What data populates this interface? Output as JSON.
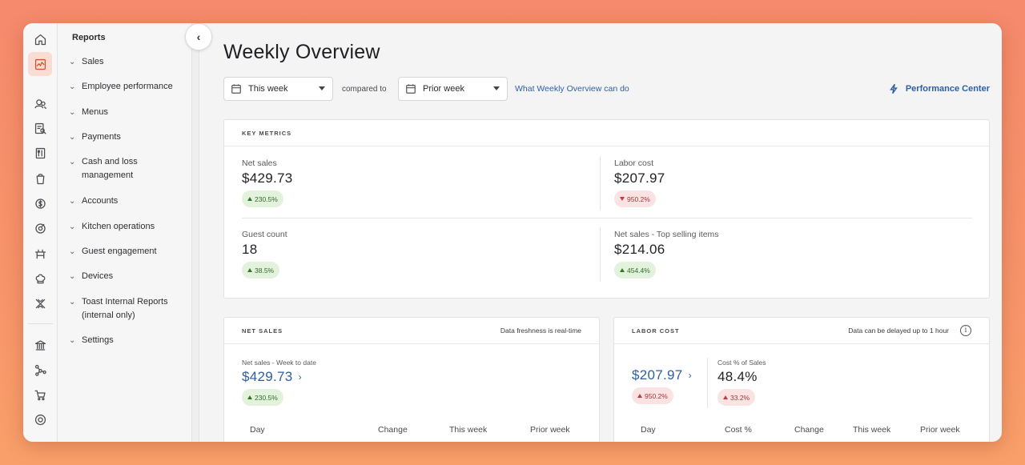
{
  "sidebar": {
    "title": "Reports",
    "items": [
      {
        "label": "Sales"
      },
      {
        "label": "Employee performance"
      },
      {
        "label": "Menus"
      },
      {
        "label": "Payments"
      },
      {
        "label": "Cash and loss management"
      },
      {
        "label": "Accounts"
      },
      {
        "label": "Kitchen operations"
      },
      {
        "label": "Guest engagement"
      },
      {
        "label": "Devices"
      },
      {
        "label": "Toast Internal Reports (internal only)"
      },
      {
        "label": "Settings"
      }
    ]
  },
  "rail": {
    "icons": [
      "home-icon",
      "reports-icon",
      "guests-icon",
      "search-receipt-icon",
      "menu-icon",
      "orders-icon",
      "payments-icon",
      "marketing-icon",
      "restaurant-icon",
      "kitchen-icon",
      "integrations-icon",
      "bank-icon",
      "network-icon",
      "cart-icon",
      "support-icon"
    ],
    "active": "reports-icon",
    "accent": "#d4512e"
  },
  "header": {
    "title": "Weekly Overview",
    "period_select": "This week",
    "compared_label": "compared to",
    "compare_select": "Prior week",
    "help_link": "What Weekly Overview can do",
    "performance_center": "Performance Center"
  },
  "key_metrics": {
    "label": "KEY METRICS",
    "metrics": [
      {
        "name": "Net sales",
        "value": "$429.73",
        "change": "230.5%",
        "direction": "up"
      },
      {
        "name": "Labor cost",
        "value": "$207.97",
        "change": "950.2%",
        "direction": "down"
      },
      {
        "name": "Guest count",
        "value": "18",
        "change": "38.5%",
        "direction": "up"
      },
      {
        "name": "Net sales - Top selling items",
        "value": "$214.06",
        "change": "454.4%",
        "direction": "up"
      }
    ]
  },
  "net_sales_card": {
    "label": "NET SALES",
    "note": "Data freshness is real-time",
    "sub_label": "Net sales - Week to date",
    "value": "$429.73",
    "change": "230.5%",
    "columns": [
      "Day",
      "Change",
      "This week",
      "Prior week"
    ]
  },
  "labor_cost_card": {
    "label": "LABOR COST",
    "note": "Data can be delayed up to 1 hour",
    "value": "$207.97",
    "change": "950.2%",
    "pct_label": "Cost % of Sales",
    "pct_value": "48.4%",
    "pct_change": "33.2%",
    "columns": [
      "Day",
      "Cost %",
      "Change",
      "This week",
      "Prior week"
    ]
  },
  "colors": {
    "link": "#2e5fa3",
    "positive_bg": "#e2f2dc",
    "negative_bg": "#fbe3e3"
  }
}
